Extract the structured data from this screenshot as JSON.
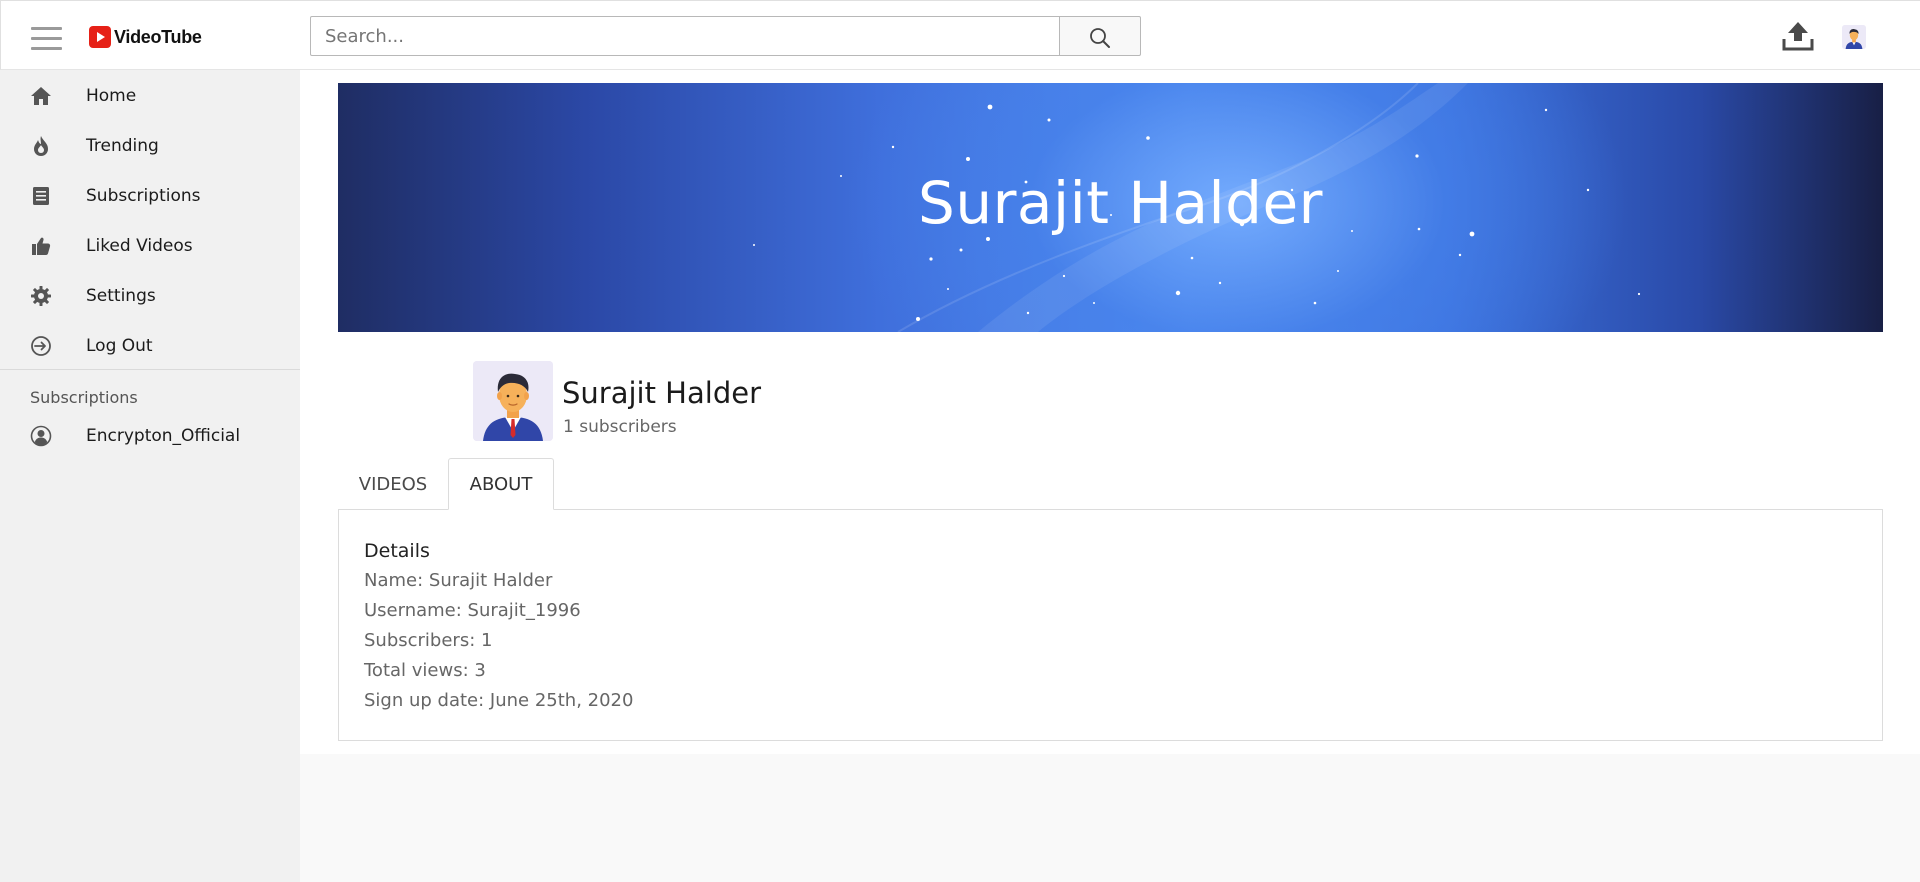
{
  "app": {
    "name": "VideoTube"
  },
  "search": {
    "placeholder": "Search..."
  },
  "sidebar": {
    "items": [
      {
        "label": "Home",
        "icon": "home-icon"
      },
      {
        "label": "Trending",
        "icon": "flame-icon"
      },
      {
        "label": "Subscriptions",
        "icon": "subscriptions-icon"
      },
      {
        "label": "Liked Videos",
        "icon": "thumbs-up-icon"
      },
      {
        "label": "Settings",
        "icon": "gear-icon"
      },
      {
        "label": "Log Out",
        "icon": "logout-icon"
      }
    ],
    "subscriptions_heading": "Subscriptions",
    "subscriptions": [
      {
        "label": "Encrypton_Official",
        "icon": "user-circle-icon"
      }
    ]
  },
  "channel": {
    "banner_title": "Surajit Halder",
    "name": "Surajit Halder",
    "subscribers": "1 subscribers"
  },
  "tabs": [
    {
      "label": "VIDEOS",
      "active": false
    },
    {
      "label": "ABOUT",
      "active": true
    }
  ],
  "about": {
    "title": "Details",
    "lines": [
      "Name: Surajit Halder",
      "Username: Surajit_1996",
      "Subscribers: 1",
      "Total views: 3",
      "Sign up date: June 25th, 2020"
    ]
  },
  "colors": {
    "brand": "#e62117",
    "banner_blue": "#4f8af0",
    "sidebar_bg": "#f1f1f1"
  }
}
